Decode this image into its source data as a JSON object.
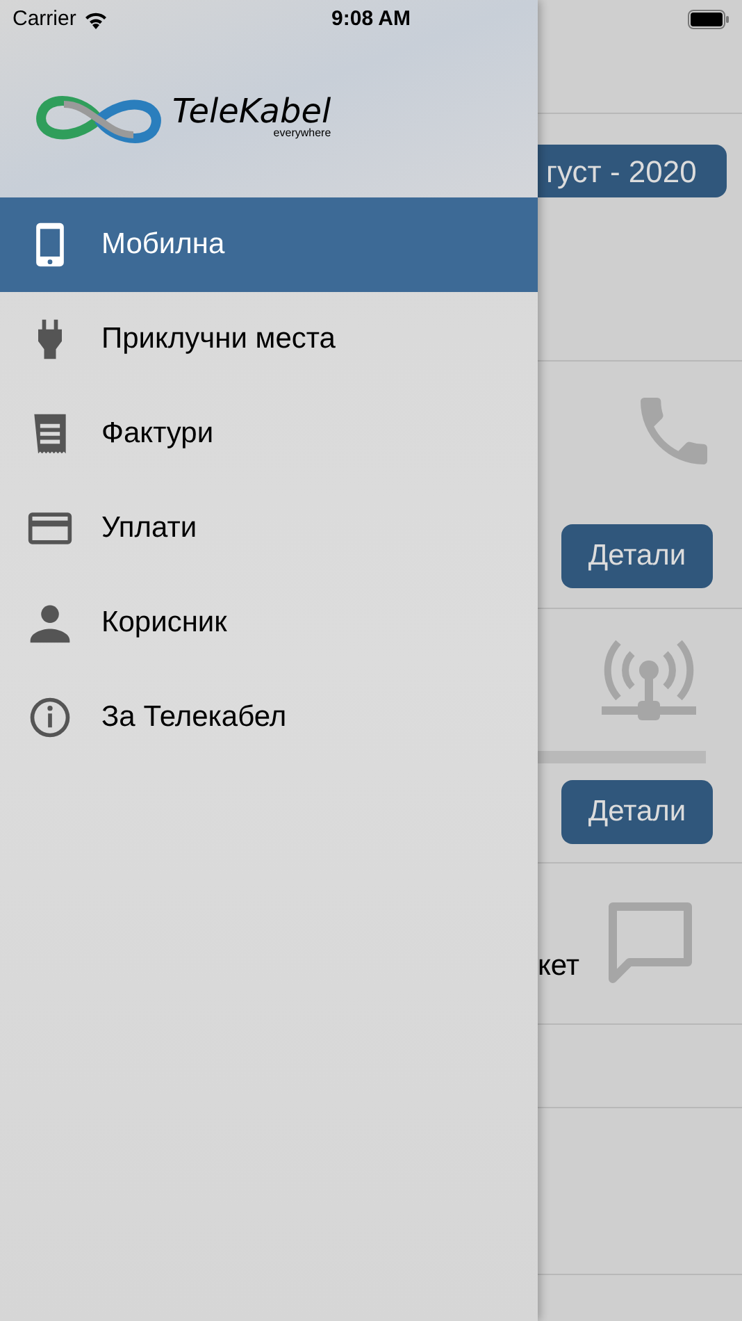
{
  "status_bar": {
    "carrier": "Carrier",
    "time": "9:08 AM"
  },
  "logo": {
    "name": "TeleKabel",
    "tagline": "everywhere"
  },
  "menu": [
    {
      "label": "Мобилна",
      "kind": "phone",
      "selected": true
    },
    {
      "label": "Приклучни места",
      "kind": "plug",
      "selected": false
    },
    {
      "label": "Фактури",
      "kind": "receipt",
      "selected": false
    },
    {
      "label": "Уплати",
      "kind": "card",
      "selected": false
    },
    {
      "label": "Корисник",
      "kind": "person",
      "selected": false
    },
    {
      "label": "За Телекабел",
      "kind": "info",
      "selected": false
    }
  ],
  "background_screen": {
    "period": "густ - 2020",
    "details_buttons": [
      "Детали",
      "Детали"
    ],
    "partial_text": "кет"
  }
}
